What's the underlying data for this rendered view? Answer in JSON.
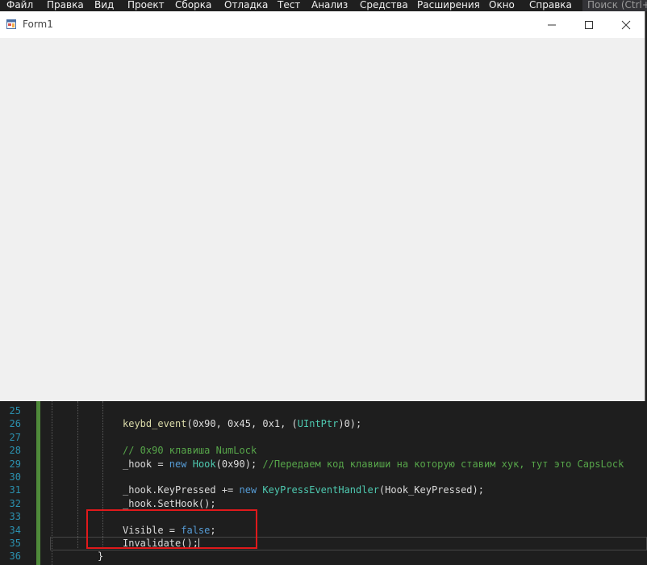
{
  "menu": {
    "items": [
      "Файл",
      "Правка",
      "Вид",
      "Проект",
      "Сборка",
      "Отладка",
      "Тест",
      "Анализ",
      "Средства",
      "Расширения",
      "Окно",
      "Справка"
    ],
    "search_placeholder": "Поиск (Ctrl+S"
  },
  "window": {
    "title": "Form1"
  },
  "editor": {
    "line_numbers": [
      "25",
      "26",
      "27",
      "28",
      "29",
      "30",
      "31",
      "32",
      "33",
      "34",
      "35",
      "36"
    ],
    "lines": {
      "l26": {
        "call": "keybd_event",
        "args_open": "(0x90, 0x45, 0x1, (",
        "cast": "UIntPtr",
        "args_close": ")0);"
      },
      "l28": "// 0x90 клавиша NumLock",
      "l29": {
        "lhs": "_hook = ",
        "kw": "new",
        "type": "Hook",
        "args": "(0x90); ",
        "comment": "//Передаем код клавиши на которую ставим хук, тут это CapsLock"
      },
      "l31": {
        "lhs": "_hook.KeyPressed += ",
        "kw": "new",
        "type": "KeyPressEventHandler",
        "args": "(Hook_KeyPressed);"
      },
      "l32": "_hook.SetHook();",
      "l34": {
        "lhs": "Visible = ",
        "kw": "false",
        "end": ";"
      },
      "l35": "Invalidate();",
      "l36": "}"
    }
  },
  "colors": {
    "highlight_box": "#e0191b",
    "menu_bg": "#1f1f1f",
    "editor_bg": "#1e1e1e",
    "form_bg": "#f0f0f0"
  }
}
